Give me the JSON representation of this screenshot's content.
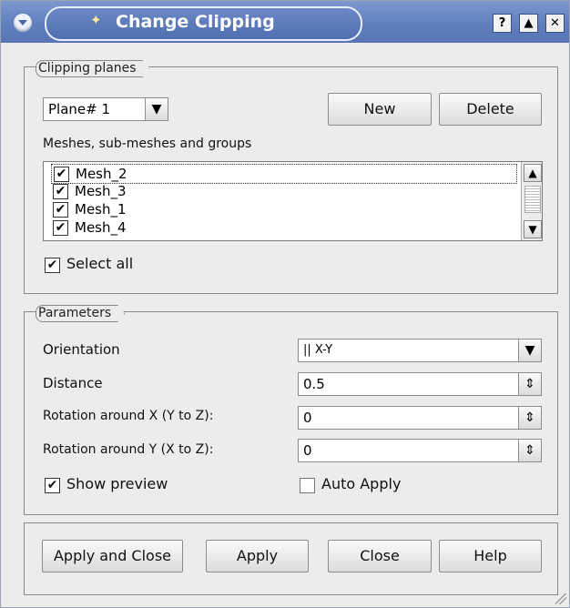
{
  "window": {
    "title": "Change Clipping"
  },
  "titlebar_buttons": {
    "help": "?",
    "maximize": "▲",
    "close": "✕"
  },
  "clipping": {
    "group_title": "Clipping planes",
    "plane_select": "Plane# 1",
    "new_label": "New",
    "delete_label": "Delete",
    "meshes_label": "Meshes, sub-meshes and groups",
    "meshes": [
      {
        "name": "Mesh_2",
        "checked": true
      },
      {
        "name": "Mesh_3",
        "checked": true
      },
      {
        "name": "Mesh_1",
        "checked": true
      },
      {
        "name": "Mesh_4",
        "checked": true
      }
    ],
    "select_all_label": "Select all",
    "select_all_checked": true
  },
  "parameters": {
    "group_title": "Parameters",
    "orientation_label": "Orientation",
    "orientation_value": "|| X-Y",
    "distance_label": "Distance",
    "distance_value": "0.5",
    "rotation_x_label": "Rotation around X (Y to Z):",
    "rotation_x_value": "0",
    "rotation_y_label": "Rotation around Y (X to Z):",
    "rotation_y_value": "0",
    "show_preview_label": "Show preview",
    "show_preview_checked": true,
    "auto_apply_label": "Auto Apply",
    "auto_apply_checked": false
  },
  "footer": {
    "apply_close_label": "Apply and Close",
    "apply_label": "Apply",
    "close_label": "Close",
    "help_label": "Help"
  },
  "icons": {
    "dropdown": "▼",
    "spin": "⇕",
    "check": "✔",
    "scroll_up": "▲",
    "scroll_down": "▼"
  }
}
